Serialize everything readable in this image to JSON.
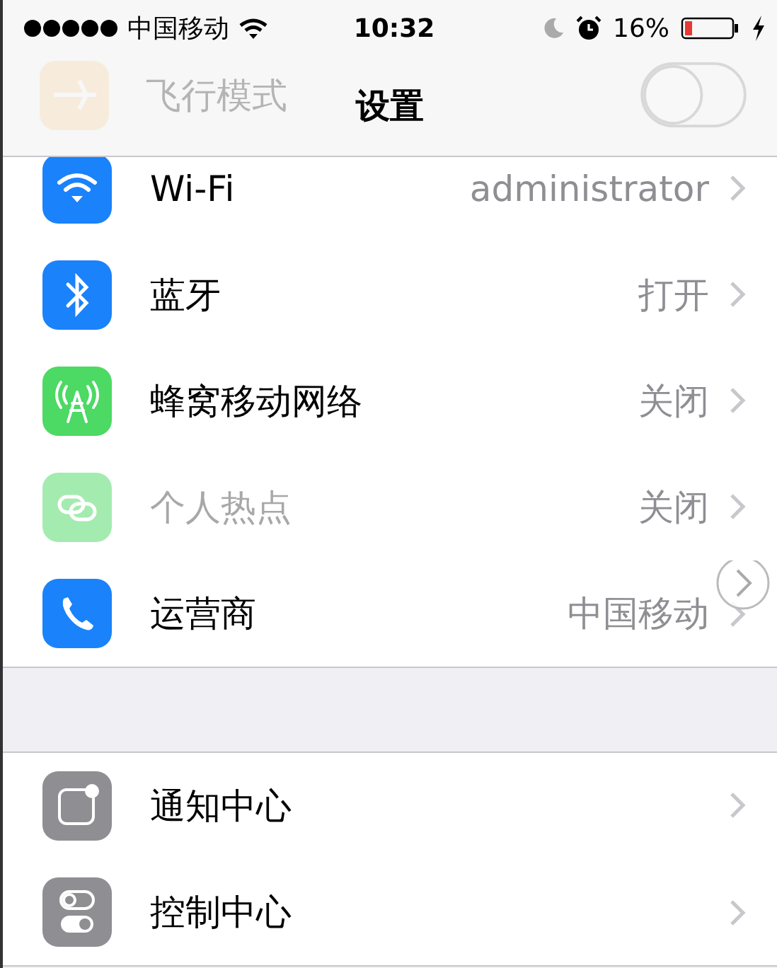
{
  "status_bar": {
    "carrier": "中国移动",
    "time": "10:32",
    "battery": "16%"
  },
  "nav_bar": {
    "title": "设置",
    "behind_row": {
      "label": "飞行模式",
      "on": false
    }
  },
  "groups": [
    {
      "rows": [
        {
          "kind": "wifi",
          "label": "Wi-Fi",
          "value": "administrator",
          "disabled": false
        },
        {
          "kind": "bluetooth",
          "label": "蓝牙",
          "value": "打开",
          "disabled": false
        },
        {
          "kind": "cellular",
          "label": "蜂窝移动网络",
          "value": "关闭",
          "disabled": false
        },
        {
          "kind": "hotspot",
          "label": "个人热点",
          "value": "关闭",
          "disabled": true
        },
        {
          "kind": "carrier",
          "label": "运营商",
          "value": "中国移动",
          "disabled": false
        }
      ]
    },
    {
      "rows": [
        {
          "kind": "notifications",
          "label": "通知中心",
          "disabled": false
        },
        {
          "kind": "control",
          "label": "控制中心",
          "disabled": false
        }
      ]
    }
  ]
}
